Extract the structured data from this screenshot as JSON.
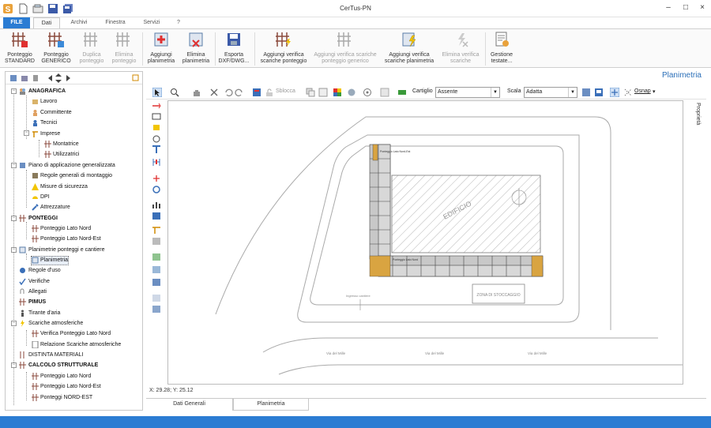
{
  "window": {
    "title": "CerTus-PN",
    "minimize": "–",
    "maximize": "□",
    "close": "×"
  },
  "tabs": [
    {
      "label": "FILE"
    },
    {
      "label": "Dati"
    },
    {
      "label": "Archivi"
    },
    {
      "label": "Finestra"
    },
    {
      "label": "Servizi"
    },
    {
      "label": "?"
    }
  ],
  "ribbon": {
    "items": [
      {
        "line1": "Ponteggio",
        "line2": "STANDARD"
      },
      {
        "line1": "Ponteggio",
        "line2": "GENERICO"
      },
      {
        "line1": "Duplica",
        "line2": "ponteggio"
      },
      {
        "line1": "Elimina",
        "line2": "ponteggio"
      },
      {
        "line1": "Aggiungi",
        "line2": "planimetria"
      },
      {
        "line1": "Elimina",
        "line2": "planimetria"
      },
      {
        "line1": "Esporta",
        "line2": "DXF/DWG..."
      },
      {
        "line1": "Aggiungi verifica",
        "line2": "scariche ponteggio"
      },
      {
        "line1": "Aggiungi verifica scariche",
        "line2": "ponteggio generico"
      },
      {
        "line1": "Aggiungi verifica",
        "line2": "scariche planimetria"
      },
      {
        "line1": "Elimina verifica",
        "line2": "scariche"
      },
      {
        "line1": "Gestione",
        "line2": "testate..."
      }
    ]
  },
  "tree": {
    "nodes": [
      {
        "label": "ANAGRAFICA"
      },
      {
        "label": "Lavoro"
      },
      {
        "label": "Committente"
      },
      {
        "label": "Tecnici"
      },
      {
        "label": "Imprese"
      },
      {
        "label": "Montatrice"
      },
      {
        "label": "Utilizzatrici"
      },
      {
        "label": "Piano di applicazione generalizzata"
      },
      {
        "label": "Regole generali di montaggio"
      },
      {
        "label": "Misure di sicurezza"
      },
      {
        "label": "DPI"
      },
      {
        "label": "Attrezzature"
      },
      {
        "label": "PONTEGGI"
      },
      {
        "label": "Ponteggio Lato Nord"
      },
      {
        "label": "Ponteggio Lato Nord-Est"
      },
      {
        "label": "Planimetrie ponteggi e cantiere"
      },
      {
        "label": "Planimetria"
      },
      {
        "label": "Regole d'uso"
      },
      {
        "label": "Verifiche"
      },
      {
        "label": "Allegati"
      },
      {
        "label": "PIMUS"
      },
      {
        "label": "Tirante d'aria"
      },
      {
        "label": "Scariche atmosferiche"
      },
      {
        "label": "Verifica Ponteggio Lato Nord"
      },
      {
        "label": "Relazione Scariche atmosferiche"
      },
      {
        "label": "DISTINTA MATERIALI"
      },
      {
        "label": "CALCOLO STRUTTURALE"
      },
      {
        "label": "Ponteggio Lato Nord"
      },
      {
        "label": "Ponteggio Lato Nord-Est"
      },
      {
        "label": "Ponteggi NORD-EST"
      }
    ]
  },
  "main": {
    "heading": "Planimetria",
    "toolbar": {
      "sblocca": "Sblocca",
      "cartiglio_label": "Cartiglio",
      "cartiglio_value": "Assente",
      "scala_label": "Scala",
      "scala_value": "Adatta",
      "osnap": "Osnap"
    },
    "properties_tab": "Proprietà",
    "coords": "X: 29.28; Y: 25.12",
    "drawing": {
      "building": "EDIFICIO",
      "storage": "ZONA DI STOCCAGGIO",
      "scaffold_label_1": "Ponteggio Lato Nord-Est",
      "scaffold_label_2": "Ponteggio Lato Nord",
      "gate": "Ingresso cantiere",
      "road_1": "Via del Mille",
      "road_2": "Via del Mille",
      "road_3": "Via del Mille"
    },
    "bottom_tabs": [
      {
        "label": "Dati Generali"
      },
      {
        "label": "Planimetria"
      }
    ]
  },
  "colors": {
    "accent": "#2b7cd3",
    "heading": "#2b6fb8",
    "scaffold": "#d9a441"
  }
}
